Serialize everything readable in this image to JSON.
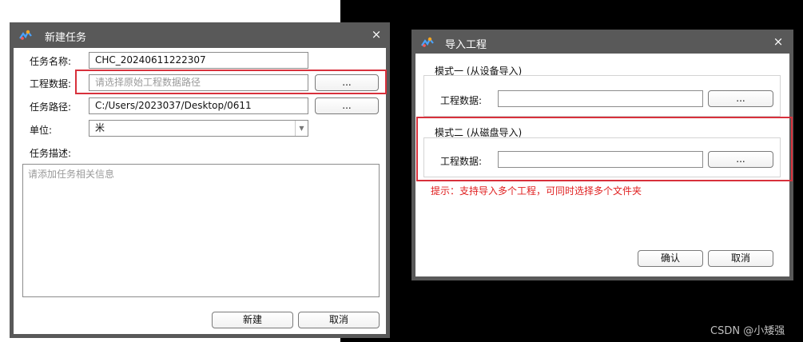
{
  "dialog_new_task": {
    "title": "新建任务",
    "close": "×",
    "fields": {
      "task_name": {
        "label": "任务名称:",
        "value": "CHC_20240611222307"
      },
      "project_data": {
        "label": "工程数据:",
        "placeholder": "请选择原始工程数据路径",
        "browse": "..."
      },
      "task_path": {
        "label": "任务路径:",
        "value": "C:/Users/2023037/Desktop/0611",
        "browse": "..."
      },
      "unit": {
        "label": "单位:",
        "value": "米",
        "arrow": "▼"
      },
      "description": {
        "label": "任务描述:",
        "placeholder": "请添加任务相关信息"
      }
    },
    "buttons": {
      "create": "新建",
      "cancel": "取消"
    }
  },
  "dialog_import_project": {
    "title": "导入工程",
    "close": "×",
    "mode1": {
      "title": "模式一 (从设备导入)",
      "label": "工程数据:",
      "browse": "..."
    },
    "mode2": {
      "title": "模式二 (从磁盘导入)",
      "label": "工程数据:",
      "browse": "..."
    },
    "tip": "提示：支持导入多个工程，可同时选择多个文件夹",
    "buttons": {
      "ok": "确认",
      "cancel": "取消"
    }
  },
  "colors": {
    "highlight": "#d8313c",
    "tip": "#e02020",
    "titlebar": "#595959"
  },
  "watermark": "CSDN @小矮强"
}
